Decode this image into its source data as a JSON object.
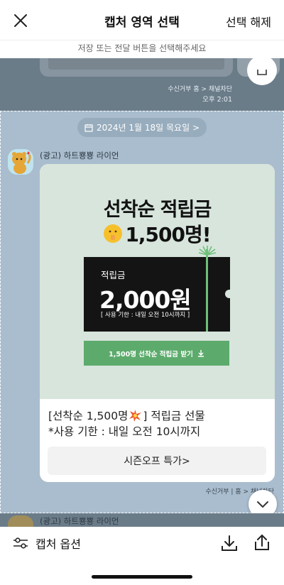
{
  "header": {
    "title": "캡처 영역 선택",
    "deselect_label": "선택 해제",
    "instruction": "저장 또는 전달 버튼을 선택해주세요"
  },
  "previous_message": {
    "meta": "수신거부  홈 > 채널차단",
    "time": "오후 2:01"
  },
  "date_divider": "2024년 1월 18일 목요일 >",
  "message": {
    "sender": "(광고) 하트뿅뿅 라이언",
    "promo_title": "선착순 적립금",
    "promo_count": "1,500명!",
    "coupon_label": "적립금",
    "coupon_amount": "2,000원",
    "coupon_expiry": "[ 사용 기한 : 내일 오전 10시까지 ]",
    "claim_button": "1,500명 선착순 적립금 받기",
    "text_line1_prefix": "[선착순 1,500명",
    "text_line1_suffix": "] 적립금 선물",
    "text_line2": "*사용 기한 : 내일 오전 10시까지",
    "season_button": "시즌오프 특가>",
    "meta": "수신거부 | 홈 > 채널차단",
    "time": "오후"
  },
  "next_message": {
    "sender": "(광고) 하트뿅뿅 라이언"
  },
  "footer": {
    "capture_options_label": "캡처 옵션"
  },
  "colors": {
    "chat_background": "#a9bdce",
    "dimmed_background": "#6b7c89",
    "promo_background": "#d7e5dc",
    "coupon_black": "#141414",
    "claim_green": "#5cab6c"
  },
  "icons": {
    "close": "close-icon",
    "calendar": "calendar-icon",
    "download": "download-icon",
    "share": "share-icon",
    "options": "sliders-icon",
    "scroll_down": "chevron-down-icon"
  }
}
